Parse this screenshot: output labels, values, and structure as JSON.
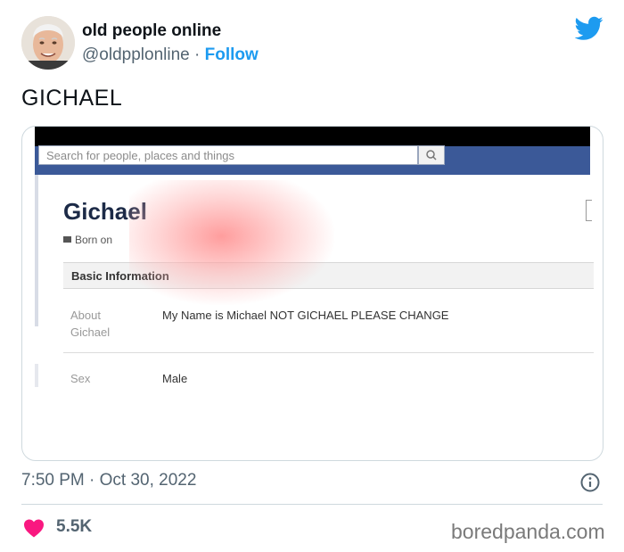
{
  "author": {
    "display_name": "old people online",
    "handle": "@oldpplonline",
    "separator": "·",
    "follow_label": "Follow"
  },
  "tweet": {
    "text": "GICHAEL",
    "timestamp": "7:50 PM · Oct 30, 2022",
    "likes": "5.5K"
  },
  "embedded_screenshot": {
    "search_placeholder": "Search for people, places and things",
    "profile_name": "Gichael",
    "born_label": "Born on",
    "section_title": "Basic Information",
    "rows": [
      {
        "label": "About\nGichael",
        "value": "My Name is Michael NOT GICHAEL PLEASE CHANGE"
      },
      {
        "label": "Sex",
        "value": "Male"
      }
    ]
  },
  "watermark": "boredpanda.com",
  "colors": {
    "twitter_blue": "#1d9bf0",
    "facebook_blue": "#3b5998",
    "like_pink": "#f91880",
    "secondary_text": "#536471"
  },
  "icons": [
    "avatar",
    "twitter-bird-icon",
    "search-icon",
    "calendar-icon",
    "info-icon",
    "heart-icon"
  ]
}
